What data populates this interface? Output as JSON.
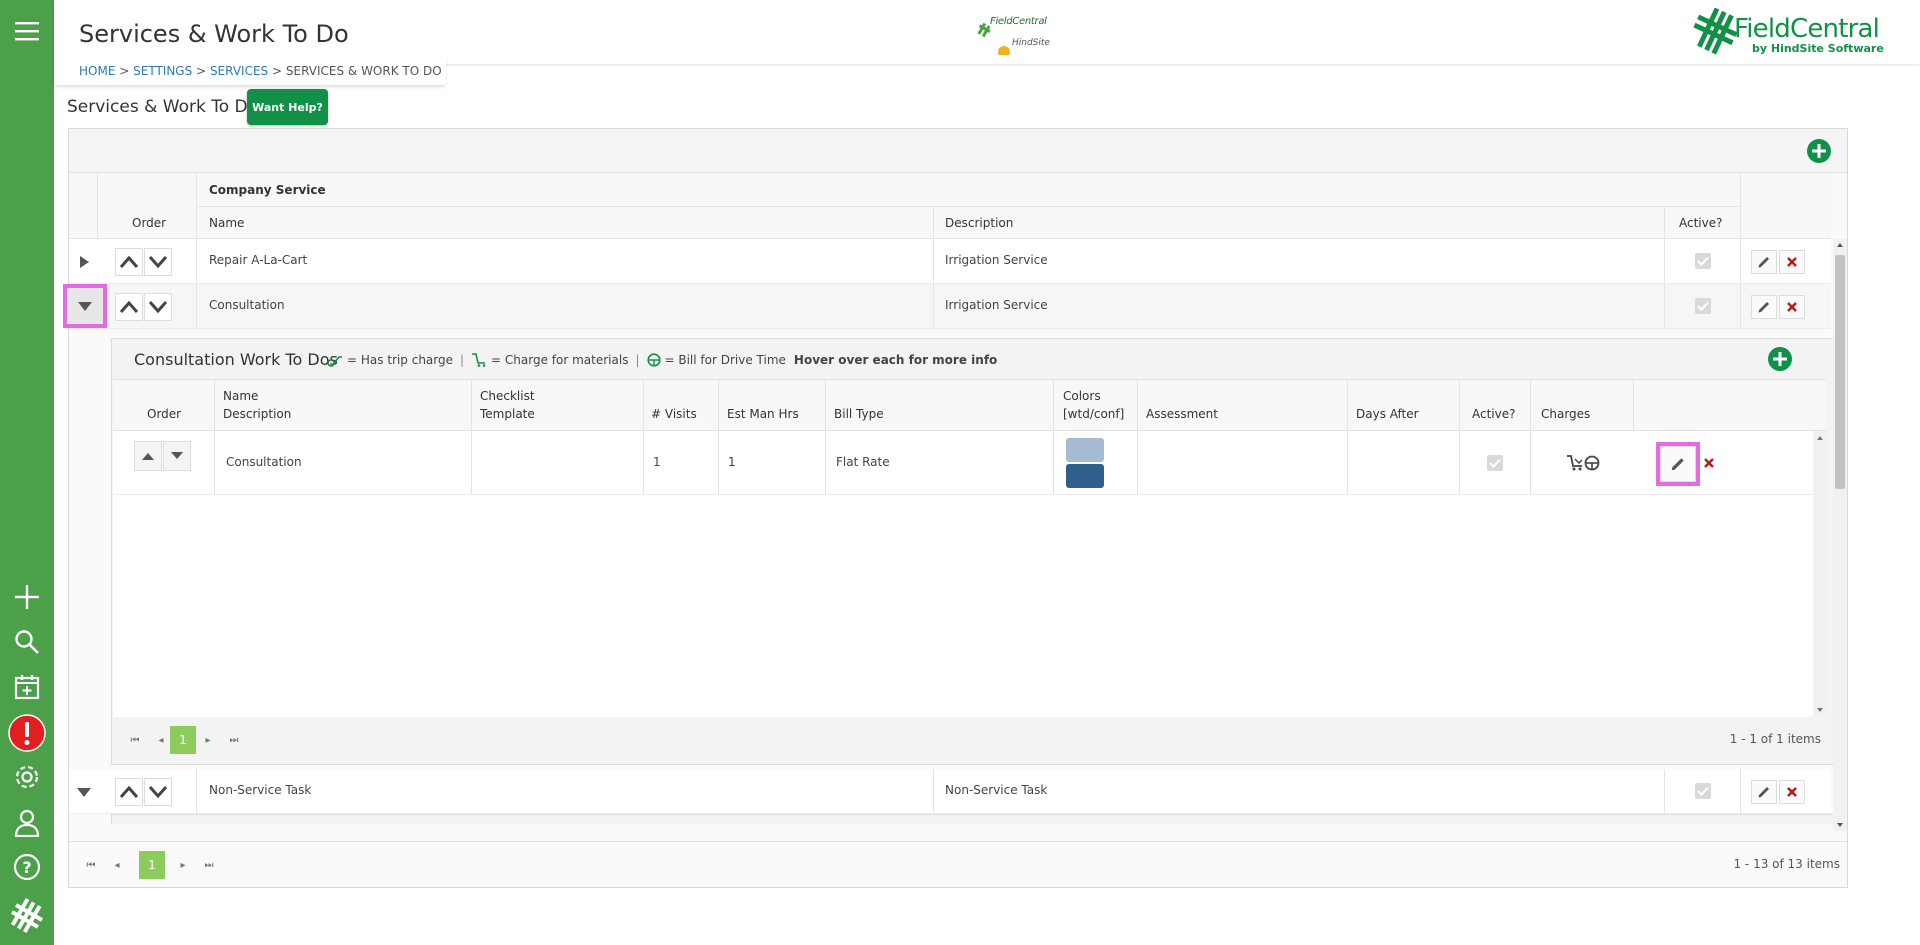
{
  "header": {
    "page_title": "Services & Work To Do",
    "breadcrumb": {
      "home": "HOME",
      "settings": "SETTINGS",
      "services": "SERVICES",
      "current": "SERVICES & WORK TO DO",
      "sep": ">"
    },
    "center_logo": {
      "line1": "FieldCentral",
      "line2": "HindSite"
    },
    "brand": {
      "name": "FieldCentral",
      "tagline": "by HindSite Software",
      "color": "#119148"
    }
  },
  "section": {
    "title": "Services & Work To Do",
    "help_label": "Want Help?"
  },
  "grid": {
    "group_header": "Company Service",
    "columns": {
      "order": "Order",
      "name": "Name",
      "description": "Description",
      "active": "Active?"
    },
    "rows": [
      {
        "name": "Repair A-La-Cart",
        "description": "Irrigation Service",
        "active": true
      },
      {
        "name": "Consultation",
        "description": "Irrigation Service",
        "active": true
      },
      {
        "name": "Non-Service Task",
        "description": "Non-Service Task",
        "active": true
      }
    ],
    "pager": {
      "page": "1",
      "summary": "1 - 13 of 13 items"
    }
  },
  "detail": {
    "title": "Consultation Work To Dos",
    "legend": {
      "trip": "= Has trip charge",
      "materials": "= Charge for materials",
      "drive": "= Bill for Drive Time",
      "hint": "Hover over each for more info",
      "sep": "|"
    },
    "columns": {
      "order": "Order",
      "name": "Name",
      "description": "Description",
      "checklist": "Checklist",
      "template": "Template",
      "visits": "# Visits",
      "est_hrs": "Est Man Hrs",
      "bill_type": "Bill Type",
      "colors": "Colors",
      "colors_sub": "[wtd/conf]",
      "assessment": "Assessment",
      "days_after": "Days After",
      "active": "Active?",
      "charges": "Charges"
    },
    "rows": [
      {
        "name": "Consultation",
        "visits": "1",
        "est_hrs": "1",
        "bill_type": "Flat Rate",
        "color_wtd": "#a6bbd3",
        "color_conf": "#2f5f8a",
        "active": true
      }
    ],
    "pager": {
      "page": "1",
      "summary": "1 - 1 of 1 items"
    }
  },
  "sidebar": {
    "icons": [
      "menu-icon",
      "add-icon",
      "search-icon",
      "calendar-add-icon",
      "alert-icon",
      "settings-icon",
      "user-icon",
      "help-icon",
      "logo-icon"
    ],
    "alert_color": "#e02020"
  },
  "colors": {
    "sidebar": "#4ca04a",
    "accent": "#119148",
    "link": "#2f77b5",
    "delete": "#b01f1f",
    "highlight": "#e36be0",
    "pager_active": "#8dcb5d"
  }
}
